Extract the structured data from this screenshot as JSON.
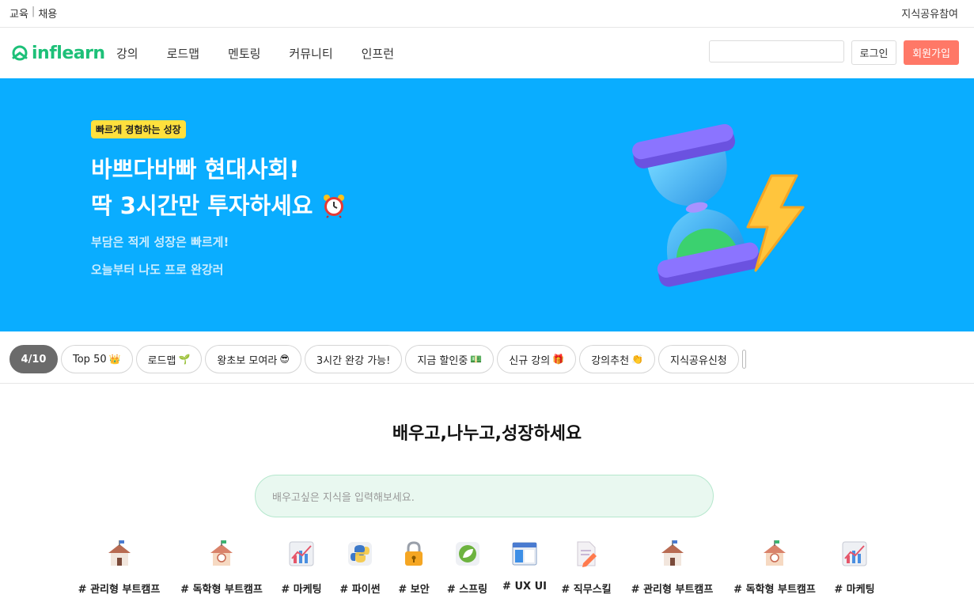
{
  "topbar": {
    "left_items": [
      "교육",
      "채용"
    ],
    "right_link": "지식공유참여"
  },
  "header": {
    "logo_text": "inflearn",
    "nav": [
      "강의",
      "로드맵",
      "멘토링",
      "커뮤니티",
      "인프런"
    ],
    "login_label": "로그인",
    "signup_label": "회원가입"
  },
  "hero": {
    "badge": "빠르게 경험하는 성장",
    "title_line1": "바쁘다바빠 현대사회!",
    "title_line2": "딱 3시간만 투자하세요",
    "sub_line1": "부담은 적게 성장은 빠르게!",
    "sub_line2": "오늘부터 나도 프로 완강러"
  },
  "chips": {
    "counter": "4/10",
    "items": [
      {
        "label": "Top 50",
        "emoji": "👑"
      },
      {
        "label": "로드맵",
        "emoji": "🌱"
      },
      {
        "label": "왕초보 모여라",
        "emoji": "😎"
      },
      {
        "label": "3시간 완강 가능!",
        "emoji": ""
      },
      {
        "label": "지금 할인중",
        "emoji": "💵"
      },
      {
        "label": "신규 강의",
        "emoji": "🎁"
      },
      {
        "label": "강의추천",
        "emoji": "👏"
      },
      {
        "label": "지식공유신청",
        "emoji": ""
      }
    ]
  },
  "section": {
    "title": "배우고,나누고,성장하세요",
    "search_placeholder": "배우고싶은 지식을 입력해보세요."
  },
  "categories": [
    {
      "label": "# 관리형 부트캠프",
      "icon": "school-icon"
    },
    {
      "label": "# 독학형 부트캠프",
      "icon": "school-clock-icon"
    },
    {
      "label": "# 마케팅",
      "icon": "chart-icon"
    },
    {
      "label": "# 파이썬",
      "icon": "python-icon"
    },
    {
      "label": "# 보안",
      "icon": "lock-icon"
    },
    {
      "label": "# 스프링",
      "icon": "spring-leaf-icon"
    },
    {
      "label": "# UX UI",
      "icon": "window-icon"
    },
    {
      "label": "# 직무스킬",
      "icon": "document-pen-icon"
    },
    {
      "label": "# 관리형 부트캠프",
      "icon": "school-icon"
    },
    {
      "label": "# 독학형 부트캠프",
      "icon": "school-clock-icon"
    },
    {
      "label": "# 마케팅",
      "icon": "chart-icon"
    }
  ],
  "colors": {
    "brand_green": "#1dc078",
    "hero_bg": "#0aadff",
    "signup": "#ff7867",
    "badge": "#ffe03d"
  }
}
